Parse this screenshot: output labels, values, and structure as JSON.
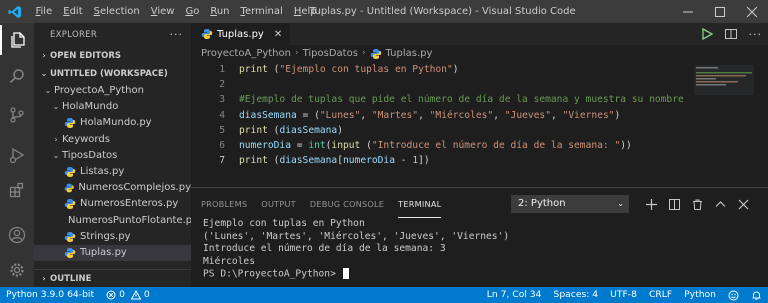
{
  "window": {
    "title": "Tuplas.py - Untitled (Workspace) - Visual Studio Code",
    "menu": [
      {
        "u": "F",
        "rest": "ile"
      },
      {
        "u": "E",
        "rest": "dit"
      },
      {
        "u": "S",
        "rest": "election"
      },
      {
        "u": "V",
        "rest": "iew"
      },
      {
        "u": "G",
        "rest": "o"
      },
      {
        "u": "R",
        "rest": "un"
      },
      {
        "u": "T",
        "rest": "erminal"
      },
      {
        "u": "H",
        "rest": "elp"
      }
    ]
  },
  "sidebar": {
    "header": "EXPLORER",
    "dots": "···",
    "open_editors": "OPEN EDITORS",
    "workspace": "UNTITLED (WORKSPACE)",
    "tree": [
      {
        "label": "ProyectoA_Python",
        "depth": 1,
        "kind": "folder-open"
      },
      {
        "label": "HolaMundo",
        "depth": 2,
        "kind": "folder-open"
      },
      {
        "label": "HolaMundo.py",
        "depth": 3,
        "kind": "py"
      },
      {
        "label": "Keywords",
        "depth": 2,
        "kind": "folder-closed"
      },
      {
        "label": "TiposDatos",
        "depth": 2,
        "kind": "folder-open"
      },
      {
        "label": "Listas.py",
        "depth": 3,
        "kind": "py"
      },
      {
        "label": "NumerosComplejos.py",
        "depth": 3,
        "kind": "py"
      },
      {
        "label": "NumerosEnteros.py",
        "depth": 3,
        "kind": "py"
      },
      {
        "label": "NumerosPuntoFlotante.py",
        "depth": 3,
        "kind": "py"
      },
      {
        "label": "Strings.py",
        "depth": 3,
        "kind": "py"
      },
      {
        "label": "Tuplas.py",
        "depth": 3,
        "kind": "py",
        "selected": true
      }
    ],
    "outline": "OUTLINE"
  },
  "editor": {
    "tab_label": "Tuplas.py",
    "breadcrumb": [
      "ProyectoA_Python",
      "TiposDatos",
      "Tuplas.py"
    ],
    "lines": [
      {
        "n": "1",
        "tokens": [
          [
            "print",
            "kw-fn"
          ],
          [
            " (",
            ""
          ],
          [
            "\"Ejemplo con tuplas en Python\"",
            "str"
          ],
          [
            ")",
            ""
          ]
        ]
      },
      {
        "n": "2",
        "tokens": []
      },
      {
        "n": "3",
        "tokens": [
          [
            "#Ejemplo de tuplas que pide el número de día de la semana y muestra su nombre",
            "cmt"
          ]
        ]
      },
      {
        "n": "4",
        "tokens": [
          [
            "diasSemana",
            "var"
          ],
          [
            " = (",
            ""
          ],
          [
            "\"Lunes\"",
            "str"
          ],
          [
            ", ",
            ""
          ],
          [
            "\"Martes\"",
            "str"
          ],
          [
            ", ",
            ""
          ],
          [
            "\"Miércoles\"",
            "str"
          ],
          [
            ", ",
            ""
          ],
          [
            "\"Jueves\"",
            "str"
          ],
          [
            ", ",
            ""
          ],
          [
            "\"Viernes\"",
            "str"
          ],
          [
            ")",
            ""
          ]
        ]
      },
      {
        "n": "5",
        "tokens": [
          [
            "print",
            "kw-fn"
          ],
          [
            " (",
            ""
          ],
          [
            "diasSemana",
            "var"
          ],
          [
            ")",
            ""
          ]
        ]
      },
      {
        "n": "6",
        "tokens": [
          [
            "numeroDia",
            "var"
          ],
          [
            " = ",
            ""
          ],
          [
            "int",
            "type"
          ],
          [
            "(",
            ""
          ],
          [
            "input",
            "kw-fn"
          ],
          [
            " (",
            ""
          ],
          [
            "\"Introduce el número de día de la semana: \"",
            "str"
          ],
          [
            "))",
            ""
          ]
        ]
      },
      {
        "n": "7",
        "tokens": [
          [
            "print",
            "kw-fn"
          ],
          [
            " (",
            ""
          ],
          [
            "diasSemana",
            "var"
          ],
          [
            "[",
            ""
          ],
          [
            "numeroDia",
            "var"
          ],
          [
            " - ",
            ""
          ],
          [
            "1",
            "num"
          ],
          [
            "])",
            ""
          ]
        ],
        "current": true
      }
    ]
  },
  "panel": {
    "tabs": [
      "PROBLEMS",
      "OUTPUT",
      "DEBUG CONSOLE",
      "TERMINAL"
    ],
    "active_tab": "TERMINAL",
    "terminal_select": "2: Python",
    "terminal_lines": [
      "Ejemplo con tuplas en Python",
      "('Lunes', 'Martes', 'Miércoles', 'Jueves', 'Viernes')",
      "Introduce el número de día de la semana: 3",
      "Miércoles",
      "PS D:\\ProyectoA_Python> "
    ]
  },
  "statusbar": {
    "python": "Python 3.9.0 64-bit",
    "errors": "0",
    "warnings": "0",
    "position": "Ln 7, Col 34",
    "spaces": "Spaces: 4",
    "encoding": "UTF-8",
    "eol": "CRLF",
    "language": "Python"
  },
  "colors": {
    "accent": "#007acc",
    "titlebar": "#3c3c3c",
    "python_icon": "#3b8eea"
  }
}
